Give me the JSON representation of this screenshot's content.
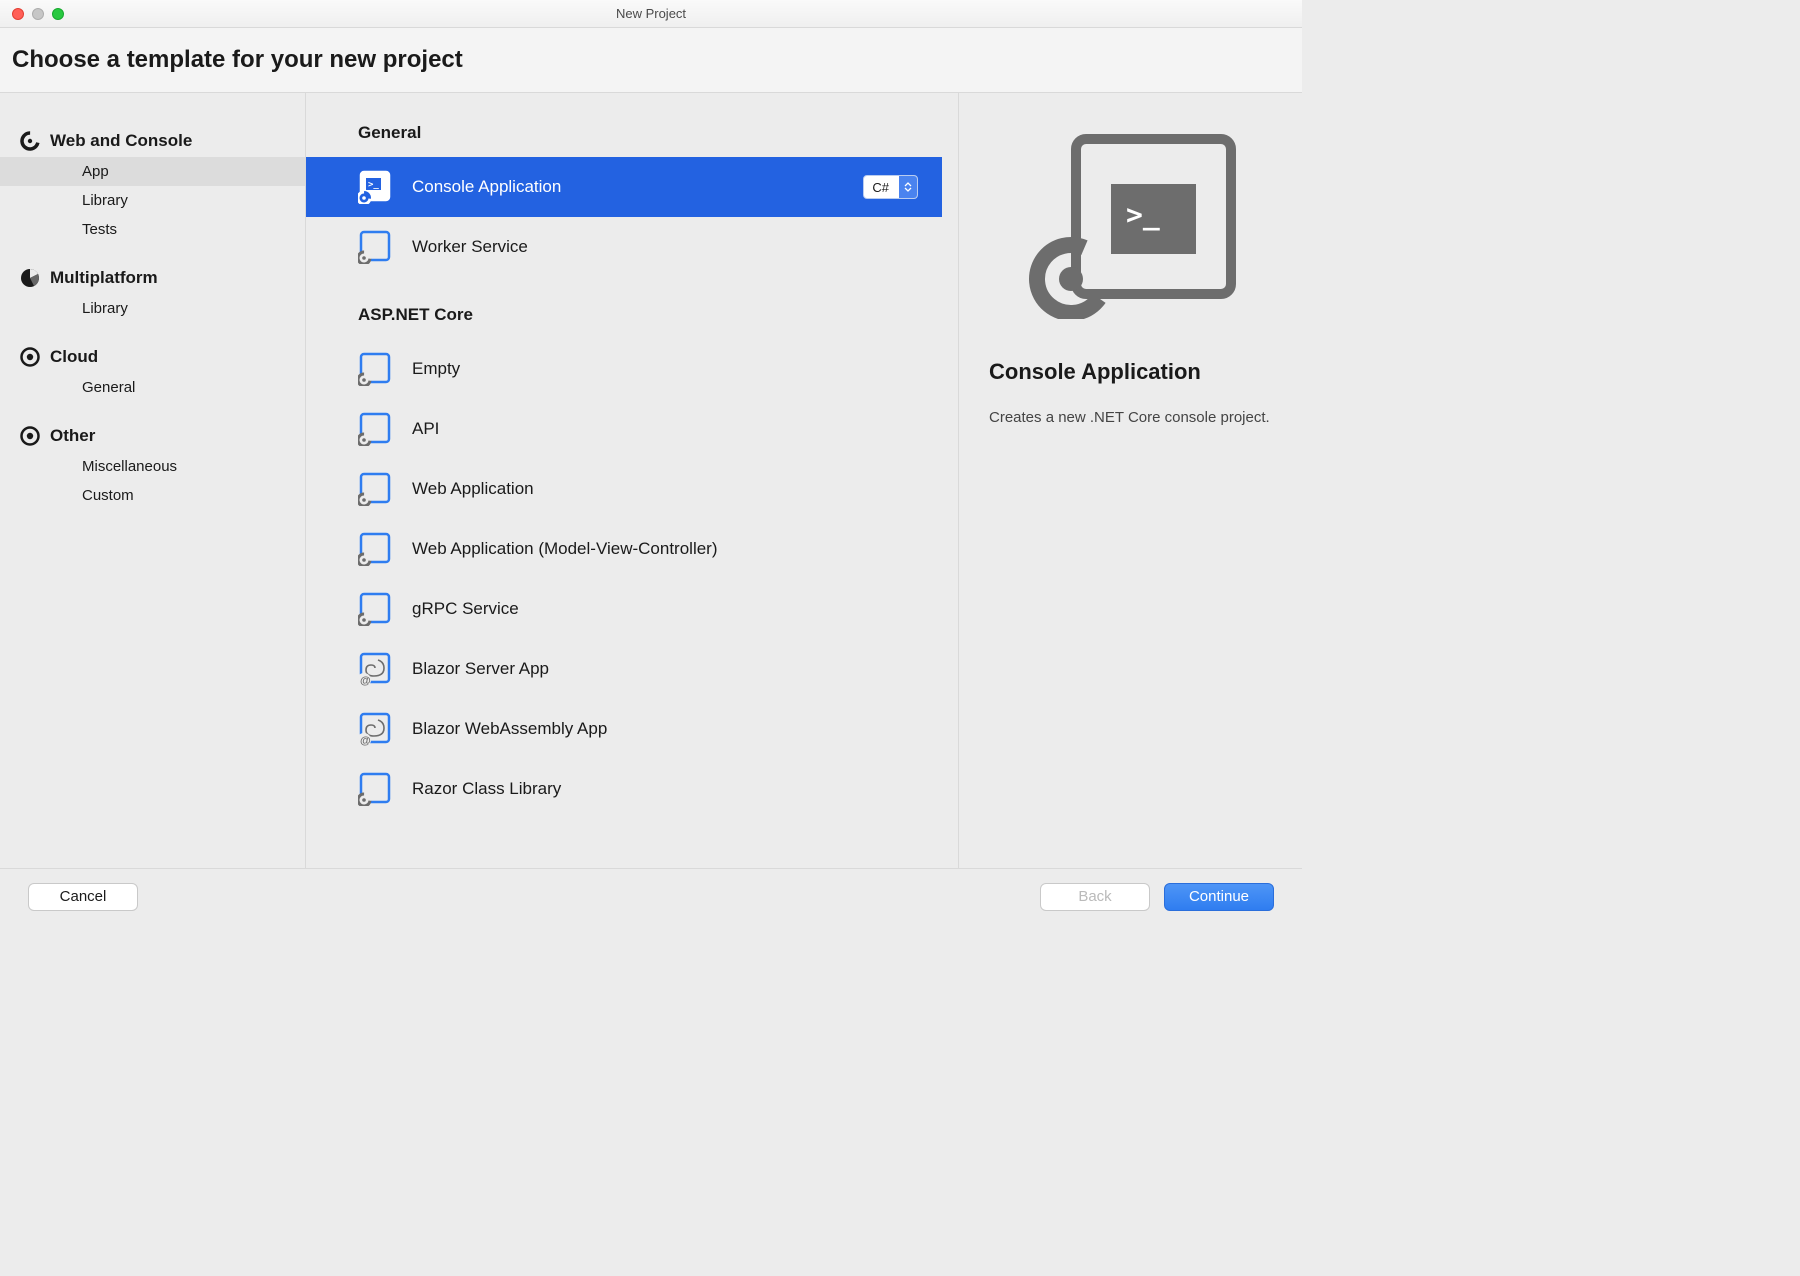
{
  "window": {
    "title": "New Project"
  },
  "header": {
    "heading": "Choose a template for your new project"
  },
  "sidebar": {
    "sections": [
      {
        "title": "Web and Console",
        "icon": "spinner-icon",
        "items": [
          {
            "label": "App",
            "selected": true
          },
          {
            "label": "Library",
            "selected": false
          },
          {
            "label": "Tests",
            "selected": false
          }
        ]
      },
      {
        "title": "Multiplatform",
        "icon": "pie-icon",
        "items": [
          {
            "label": "Library",
            "selected": false
          }
        ]
      },
      {
        "title": "Cloud",
        "icon": "target-icon",
        "items": [
          {
            "label": "General",
            "selected": false
          }
        ]
      },
      {
        "title": "Other",
        "icon": "target-icon",
        "items": [
          {
            "label": "Miscellaneous",
            "selected": false
          },
          {
            "label": "Custom",
            "selected": false
          }
        ]
      }
    ]
  },
  "templates": {
    "groups": [
      {
        "heading": "General",
        "items": [
          {
            "label": "Console Application",
            "icon": "console-icon",
            "selected": true,
            "language": "C#"
          },
          {
            "label": "Worker Service",
            "icon": "project-icon",
            "selected": false
          }
        ]
      },
      {
        "heading": "ASP.NET Core",
        "items": [
          {
            "label": "Empty",
            "icon": "project-icon",
            "selected": false
          },
          {
            "label": "API",
            "icon": "project-icon",
            "selected": false
          },
          {
            "label": "Web Application",
            "icon": "project-icon",
            "selected": false
          },
          {
            "label": "Web Application (Model-View-Controller)",
            "icon": "project-icon",
            "selected": false
          },
          {
            "label": "gRPC Service",
            "icon": "project-icon",
            "selected": false
          },
          {
            "label": "Blazor Server App",
            "icon": "blazor-icon",
            "selected": false
          },
          {
            "label": "Blazor WebAssembly App",
            "icon": "blazor-icon",
            "selected": false
          },
          {
            "label": "Razor Class Library",
            "icon": "project-icon",
            "selected": false
          }
        ]
      }
    ]
  },
  "detail": {
    "title": "Console Application",
    "description": "Creates a new .NET Core console project."
  },
  "footer": {
    "cancel": "Cancel",
    "back": "Back",
    "continue": "Continue"
  }
}
